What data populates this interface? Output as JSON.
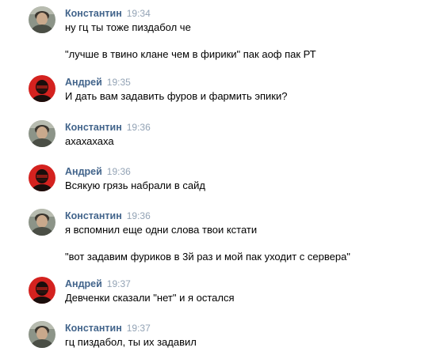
{
  "messages": [
    {
      "author": "Константин",
      "avatar": "user-photo-konstantin",
      "time": "19:34",
      "lines": [
        "ну гц ты тоже пиздабол че",
        "\"лучше в твино клане чем в фирики\" пак аоф пак РТ"
      ]
    },
    {
      "author": "Андрей",
      "avatar": "user-photo-andrey",
      "time": "19:35",
      "lines": [
        "И дать вам задавить фуров и фармить эпики?"
      ]
    },
    {
      "author": "Константин",
      "avatar": "user-photo-konstantin",
      "time": "19:36",
      "lines": [
        "ахахахаха"
      ]
    },
    {
      "author": "Андрей",
      "avatar": "user-photo-andrey",
      "time": "19:36",
      "lines": [
        "Всякую грязь набрали в сайд"
      ]
    },
    {
      "author": "Константин",
      "avatar": "user-photo-konstantin",
      "time": "19:36",
      "lines": [
        "я вспомнил еще одни слова твои кстати",
        "\"вот задавим фуриков в 3й раз и мой пак уходит с сервера\""
      ]
    },
    {
      "author": "Андрей",
      "avatar": "user-photo-andrey",
      "time": "19:37",
      "lines": [
        "Девченки сказали \"нет\" и я остался"
      ]
    },
    {
      "author": "Константин",
      "avatar": "user-photo-konstantin",
      "time": "19:37",
      "lines": [
        "гц пиздабол, ты их задавил"
      ]
    }
  ]
}
